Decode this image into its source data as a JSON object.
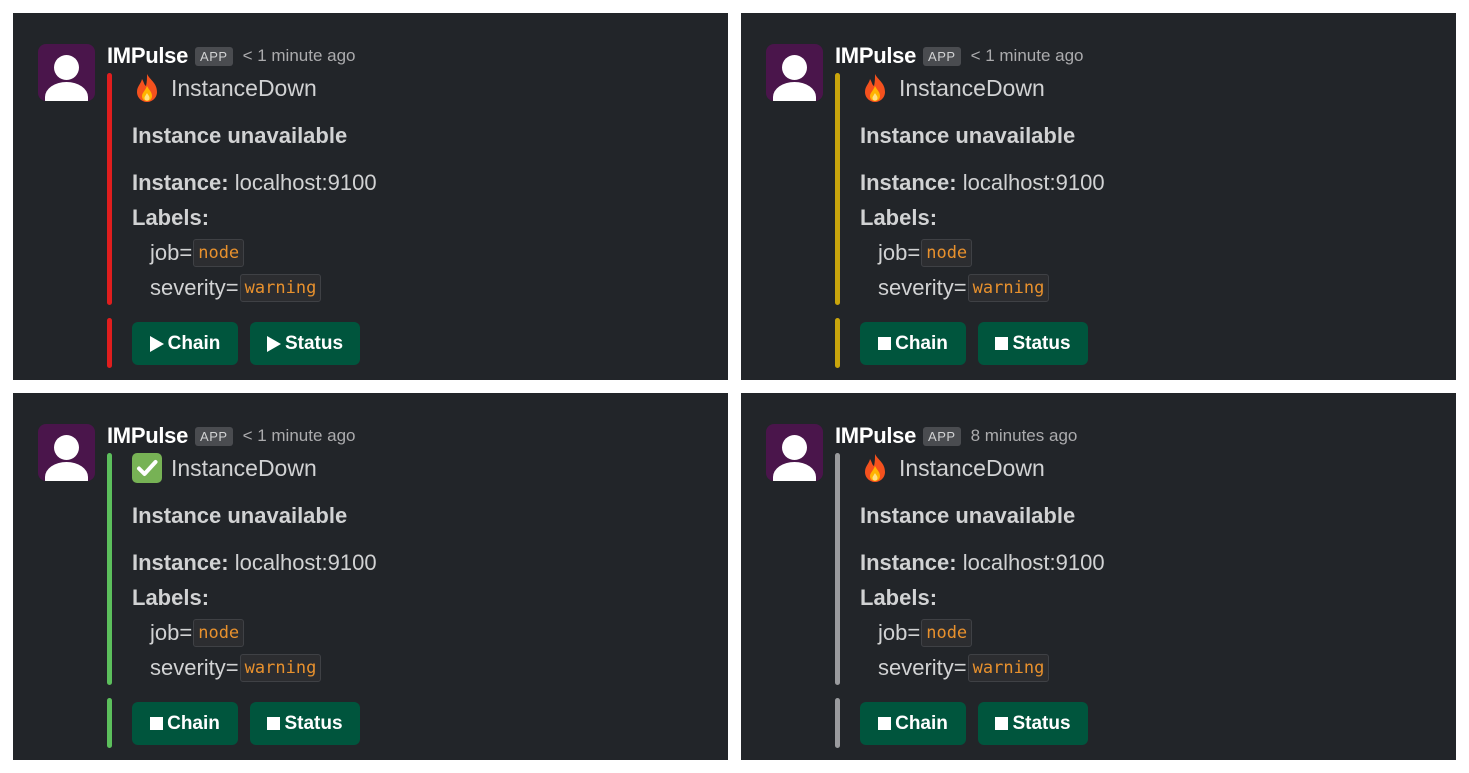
{
  "panels": [
    {
      "app_name": "IMPulse",
      "app_badge": "APP",
      "timestamp": "< 1 minute ago",
      "status_icon": "fire-icon",
      "alert_name": "InstanceDown",
      "summary": "Instance unavailable",
      "instance_label": "Instance:",
      "instance_value": "localhost:9100",
      "labels_title": "Labels:",
      "label_job_key": "job=",
      "label_job_value": "node",
      "label_severity_key": "severity=",
      "label_severity_value": "warning",
      "bar_color": "#e01e1e",
      "button_icon": "play-icon",
      "chain_label": "Chain",
      "status_label": "Status"
    },
    {
      "app_name": "IMPulse",
      "app_badge": "APP",
      "timestamp": "< 1 minute ago",
      "status_icon": "fire-icon",
      "alert_name": "InstanceDown",
      "summary": "Instance unavailable",
      "instance_label": "Instance:",
      "instance_value": "localhost:9100",
      "labels_title": "Labels:",
      "label_job_key": "job=",
      "label_job_value": "node",
      "label_severity_key": "severity=",
      "label_severity_value": "warning",
      "bar_color": "#c9a50c",
      "button_icon": "stop-icon",
      "chain_label": "Chain",
      "status_label": "Status"
    },
    {
      "app_name": "IMPulse",
      "app_badge": "APP",
      "timestamp": "< 1 minute ago",
      "status_icon": "check-icon",
      "alert_name": "InstanceDown",
      "summary": "Instance unavailable",
      "instance_label": "Instance:",
      "instance_value": "localhost:9100",
      "labels_title": "Labels:",
      "label_job_key": "job=",
      "label_job_value": "node",
      "label_severity_key": "severity=",
      "label_severity_value": "warning",
      "bar_color": "#5cbf5c",
      "button_icon": "stop-icon",
      "chain_label": "Chain",
      "status_label": "Status"
    },
    {
      "app_name": "IMPulse",
      "app_badge": "APP",
      "timestamp": "8 minutes ago",
      "status_icon": "fire-icon",
      "alert_name": "InstanceDown",
      "summary": "Instance unavailable",
      "instance_label": "Instance:",
      "instance_value": "localhost:9100",
      "labels_title": "Labels:",
      "label_job_key": "job=",
      "label_job_value": "node",
      "label_severity_key": "severity=",
      "label_severity_value": "warning",
      "bar_color": "#9a9b9e",
      "button_icon": "stop-icon",
      "chain_label": "Chain",
      "status_label": "Status"
    }
  ]
}
